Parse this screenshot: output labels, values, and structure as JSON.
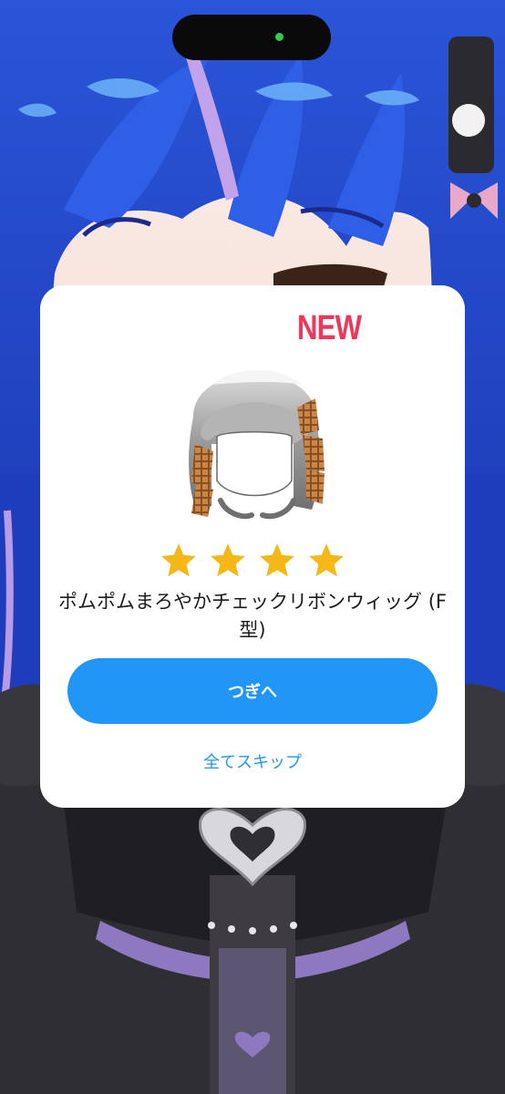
{
  "reward": {
    "badge": "NEW",
    "item_name": "ポムポムまろやかチェックリボンウィッグ (F型)",
    "rating": 4,
    "next_label": "つぎへ",
    "skip_label": "全てスキップ"
  },
  "icons": {
    "rating_star": "star-icon",
    "item_image": "wig-image"
  },
  "colors": {
    "accent": "#2196f7",
    "badge": "#f2355b",
    "star": "#f6b817",
    "hair": "#2446c9",
    "dress": "#3e3c42",
    "status_dot": "#34c759"
  }
}
